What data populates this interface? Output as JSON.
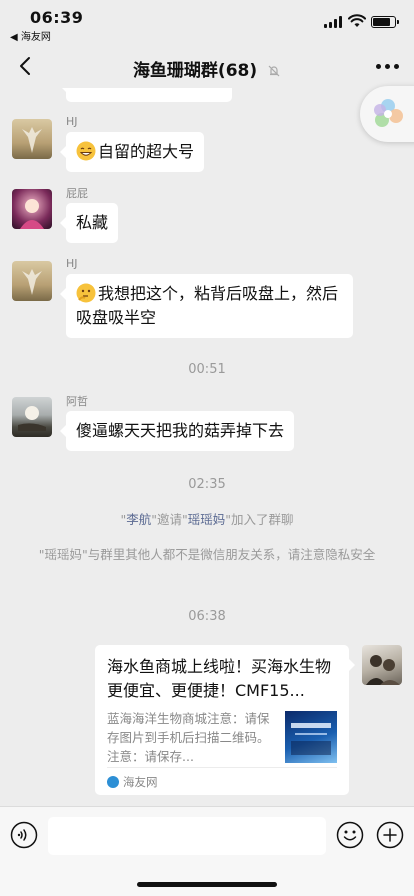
{
  "status_bar": {
    "time": "06:39",
    "back_app": "◀ 海友网"
  },
  "nav": {
    "title": "海鱼珊瑚群(68)"
  },
  "messages": [
    {
      "sender": "HJ",
      "text": "自留的超大号"
    },
    {
      "sender": "屁屁",
      "text": "私藏"
    },
    {
      "sender": "HJ",
      "text": "我想把这个，粘背后吸盘上，然后吸盘吸半空"
    },
    {
      "sender": "阿哲",
      "text": "傻逼螺天天把我的菇弄掉下去"
    }
  ],
  "timestamps": [
    "00:51",
    "02:35",
    "06:38"
  ],
  "system": {
    "invite_q1": "\"",
    "invite_name1": "李航",
    "invite_mid": "\"邀请\"",
    "invite_name2": "瑶瑶妈",
    "invite_end": "\"加入了群聊",
    "notice": "\"瑶瑶妈\"与群里其他人都不是微信朋友关系，请注意隐私安全"
  },
  "share_card": {
    "title": "海水鱼商城上线啦！买海水生物更便宜、更便捷！CMF15...",
    "desc": "蓝海海洋生物商城注意：请保存图片到手机后扫描二维码。注意：请保存...",
    "source": "海友网"
  },
  "icons": [
    "back-icon",
    "mute-icon",
    "more-icon",
    "voice-icon",
    "emoji-icon",
    "add-icon"
  ]
}
